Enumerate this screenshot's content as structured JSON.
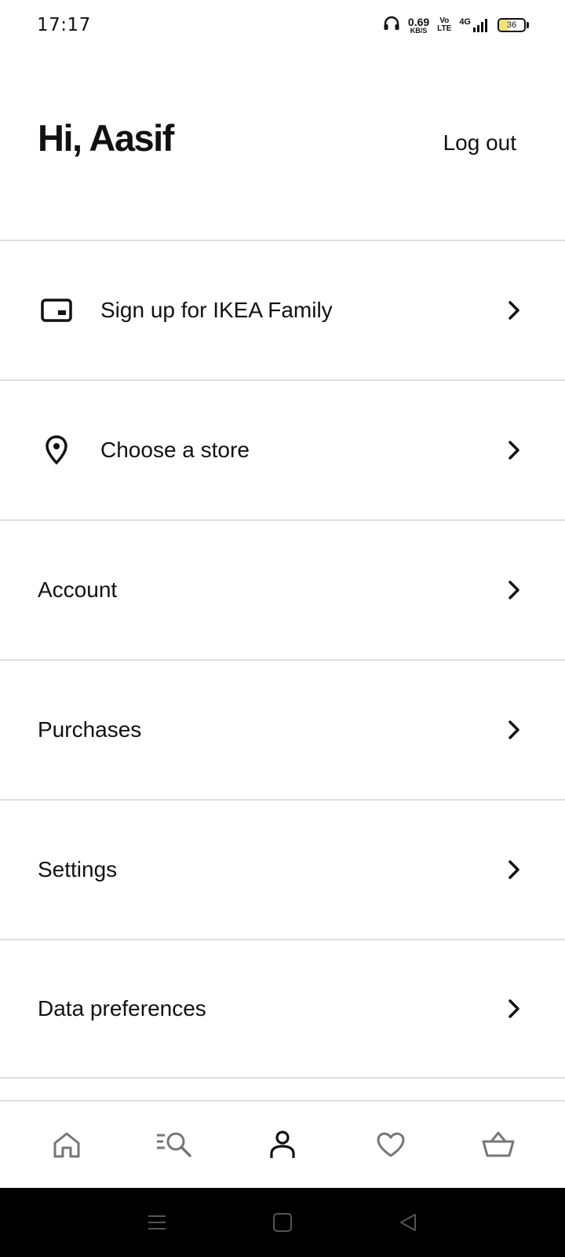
{
  "status": {
    "time": "17:17",
    "speed_value": "0.69",
    "speed_unit": "KB/S",
    "volte_top": "Vo",
    "volte_bottom": "LTE",
    "network": "4G",
    "battery": "36",
    "battery_level": 0.36,
    "battery_fill_color": "#f1e27a"
  },
  "header": {
    "greeting": "Hi, Aasif",
    "logout_label": "Log out"
  },
  "menu": {
    "items": [
      {
        "label": "Sign up for IKEA Family",
        "icon": "card-icon"
      },
      {
        "label": "Choose a store",
        "icon": "location-pin-icon"
      },
      {
        "label": "Account"
      },
      {
        "label": "Purchases"
      },
      {
        "label": "Settings"
      },
      {
        "label": "Data preferences"
      }
    ]
  },
  "bottom_nav": {
    "items": [
      {
        "icon": "home-icon",
        "active": false
      },
      {
        "icon": "search-icon",
        "active": false
      },
      {
        "icon": "profile-icon",
        "active": true
      },
      {
        "icon": "heart-icon",
        "active": false
      },
      {
        "icon": "basket-icon",
        "active": false
      }
    ],
    "active_color": "#111111",
    "inactive_color": "#767676"
  },
  "system_nav": {
    "items": [
      "menu-icon",
      "home-square-icon",
      "back-icon"
    ]
  }
}
